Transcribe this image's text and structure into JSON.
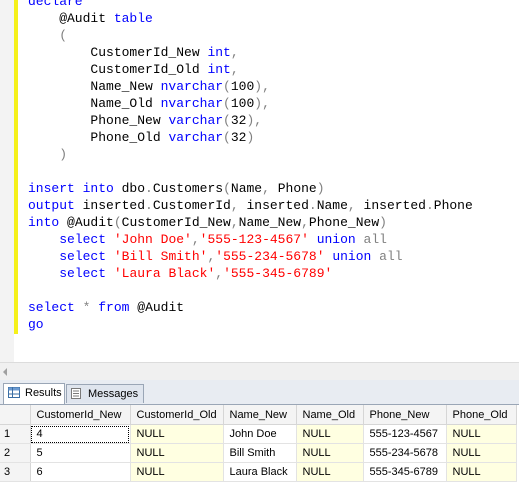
{
  "editor": {
    "lines": [
      [
        {
          "t": "declare",
          "c": "kw"
        }
      ],
      [
        {
          "t": "    @Audit "
        },
        {
          "t": "table",
          "c": "kw"
        }
      ],
      [
        {
          "t": "    (",
          "c": "gray"
        }
      ],
      [
        {
          "t": "        CustomerId_New "
        },
        {
          "t": "int",
          "c": "kw"
        },
        {
          "t": ",",
          "c": "gray"
        }
      ],
      [
        {
          "t": "        CustomerId_Old "
        },
        {
          "t": "int",
          "c": "kw"
        },
        {
          "t": ",",
          "c": "gray"
        }
      ],
      [
        {
          "t": "        Name_New "
        },
        {
          "t": "nvarchar",
          "c": "kw"
        },
        {
          "t": "(",
          "c": "gray"
        },
        {
          "t": "100"
        },
        {
          "t": "),",
          "c": "gray"
        }
      ],
      [
        {
          "t": "        Name_Old "
        },
        {
          "t": "nvarchar",
          "c": "kw"
        },
        {
          "t": "(",
          "c": "gray"
        },
        {
          "t": "100"
        },
        {
          "t": "),",
          "c": "gray"
        }
      ],
      [
        {
          "t": "        Phone_New "
        },
        {
          "t": "varchar",
          "c": "kw"
        },
        {
          "t": "(",
          "c": "gray"
        },
        {
          "t": "32"
        },
        {
          "t": "),",
          "c": "gray"
        }
      ],
      [
        {
          "t": "        Phone_Old "
        },
        {
          "t": "varchar",
          "c": "kw"
        },
        {
          "t": "(",
          "c": "gray"
        },
        {
          "t": "32"
        },
        {
          "t": ")",
          "c": "gray"
        }
      ],
      [
        {
          "t": "    )",
          "c": "gray"
        }
      ],
      [],
      [
        {
          "t": "insert into",
          "c": "kw"
        },
        {
          "t": " dbo"
        },
        {
          "t": ".",
          "c": "gray"
        },
        {
          "t": "Customers"
        },
        {
          "t": "(",
          "c": "gray"
        },
        {
          "t": "Name"
        },
        {
          "t": ",",
          "c": "gray"
        },
        {
          "t": " Phone"
        },
        {
          "t": ")",
          "c": "gray"
        }
      ],
      [
        {
          "t": "output",
          "c": "kw"
        },
        {
          "t": " inserted"
        },
        {
          "t": ".",
          "c": "gray"
        },
        {
          "t": "CustomerId"
        },
        {
          "t": ",",
          "c": "gray"
        },
        {
          "t": " inserted"
        },
        {
          "t": ".",
          "c": "gray"
        },
        {
          "t": "Name"
        },
        {
          "t": ",",
          "c": "gray"
        },
        {
          "t": " inserted"
        },
        {
          "t": ".",
          "c": "gray"
        },
        {
          "t": "Phone"
        }
      ],
      [
        {
          "t": "into",
          "c": "kw"
        },
        {
          "t": " @Audit"
        },
        {
          "t": "(",
          "c": "gray"
        },
        {
          "t": "CustomerId_New"
        },
        {
          "t": ",",
          "c": "gray"
        },
        {
          "t": "Name_New"
        },
        {
          "t": ",",
          "c": "gray"
        },
        {
          "t": "Phone_New"
        },
        {
          "t": ")",
          "c": "gray"
        }
      ],
      [
        {
          "t": "    "
        },
        {
          "t": "select",
          "c": "kw"
        },
        {
          "t": " "
        },
        {
          "t": "'John Doe'",
          "c": "str"
        },
        {
          "t": ",",
          "c": "gray"
        },
        {
          "t": "'555-123-4567'",
          "c": "str"
        },
        {
          "t": " "
        },
        {
          "t": "union",
          "c": "kw"
        },
        {
          "t": " "
        },
        {
          "t": "all",
          "c": "gray"
        }
      ],
      [
        {
          "t": "    "
        },
        {
          "t": "select",
          "c": "kw"
        },
        {
          "t": " "
        },
        {
          "t": "'Bill Smith'",
          "c": "str"
        },
        {
          "t": ",",
          "c": "gray"
        },
        {
          "t": "'555-234-5678'",
          "c": "str"
        },
        {
          "t": " "
        },
        {
          "t": "union",
          "c": "kw"
        },
        {
          "t": " "
        },
        {
          "t": "all",
          "c": "gray"
        }
      ],
      [
        {
          "t": "    "
        },
        {
          "t": "select",
          "c": "kw"
        },
        {
          "t": " "
        },
        {
          "t": "'Laura Black'",
          "c": "str"
        },
        {
          "t": ",",
          "c": "gray"
        },
        {
          "t": "'555-345-6789'",
          "c": "str"
        }
      ],
      [],
      [
        {
          "t": "select",
          "c": "kw"
        },
        {
          "t": " "
        },
        {
          "t": "*",
          "c": "gray"
        },
        {
          "t": " "
        },
        {
          "t": "from",
          "c": "kw"
        },
        {
          "t": " @Audit"
        }
      ],
      [
        {
          "t": "go",
          "c": "kw"
        }
      ]
    ]
  },
  "tabs": [
    {
      "label": "Results",
      "icon": "grid-icon",
      "active": true
    },
    {
      "label": "Messages",
      "icon": "messages-icon",
      "active": false
    }
  ],
  "results": {
    "columns": [
      "CustomerId_New",
      "CustomerId_Old",
      "Name_New",
      "Name_Old",
      "Phone_New",
      "Phone_Old"
    ],
    "rows": [
      {
        "num": "1",
        "cells": [
          "4",
          "NULL",
          "John Doe",
          "NULL",
          "555-123-4567",
          "NULL"
        ]
      },
      {
        "num": "2",
        "cells": [
          "5",
          "NULL",
          "Bill Smith",
          "NULL",
          "555-234-5678",
          "NULL"
        ]
      },
      {
        "num": "3",
        "cells": [
          "6",
          "NULL",
          "Laura Black",
          "NULL",
          "555-345-6789",
          "NULL"
        ]
      }
    ]
  },
  "colors": {
    "keyword": "#0000ff",
    "string": "#ff0000",
    "operator": "#808080",
    "null_cell": "#ffffe1",
    "change_bar": "#f5f01a"
  }
}
